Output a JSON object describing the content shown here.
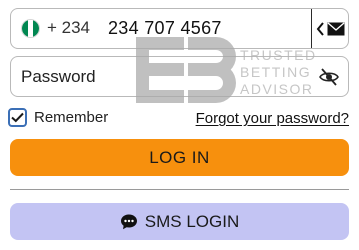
{
  "phone": {
    "country_code": "+ 234",
    "number": "234 707 4567",
    "flag_icon": "nigeria-flag-icon",
    "actions_icons": [
      "chevron-left-icon",
      "envelope-icon"
    ]
  },
  "password": {
    "placeholder": "Password",
    "visibility_icon": "eye-slash-icon"
  },
  "remember": {
    "label": "Remember",
    "checked": true
  },
  "forgot_link": "Forgot your password?",
  "buttons": {
    "login": "LOG IN",
    "sms": "SMS LOGIN",
    "sms_icon": "chat-bubble-icon"
  },
  "watermark": {
    "line1": "TRUSTED",
    "line2": "BETTING",
    "line3": "ADVISOR"
  },
  "colors": {
    "accent_orange": "#f7900d",
    "sms_lavender": "#c3c4f3",
    "checkbox_blue": "#3b6fb6"
  }
}
